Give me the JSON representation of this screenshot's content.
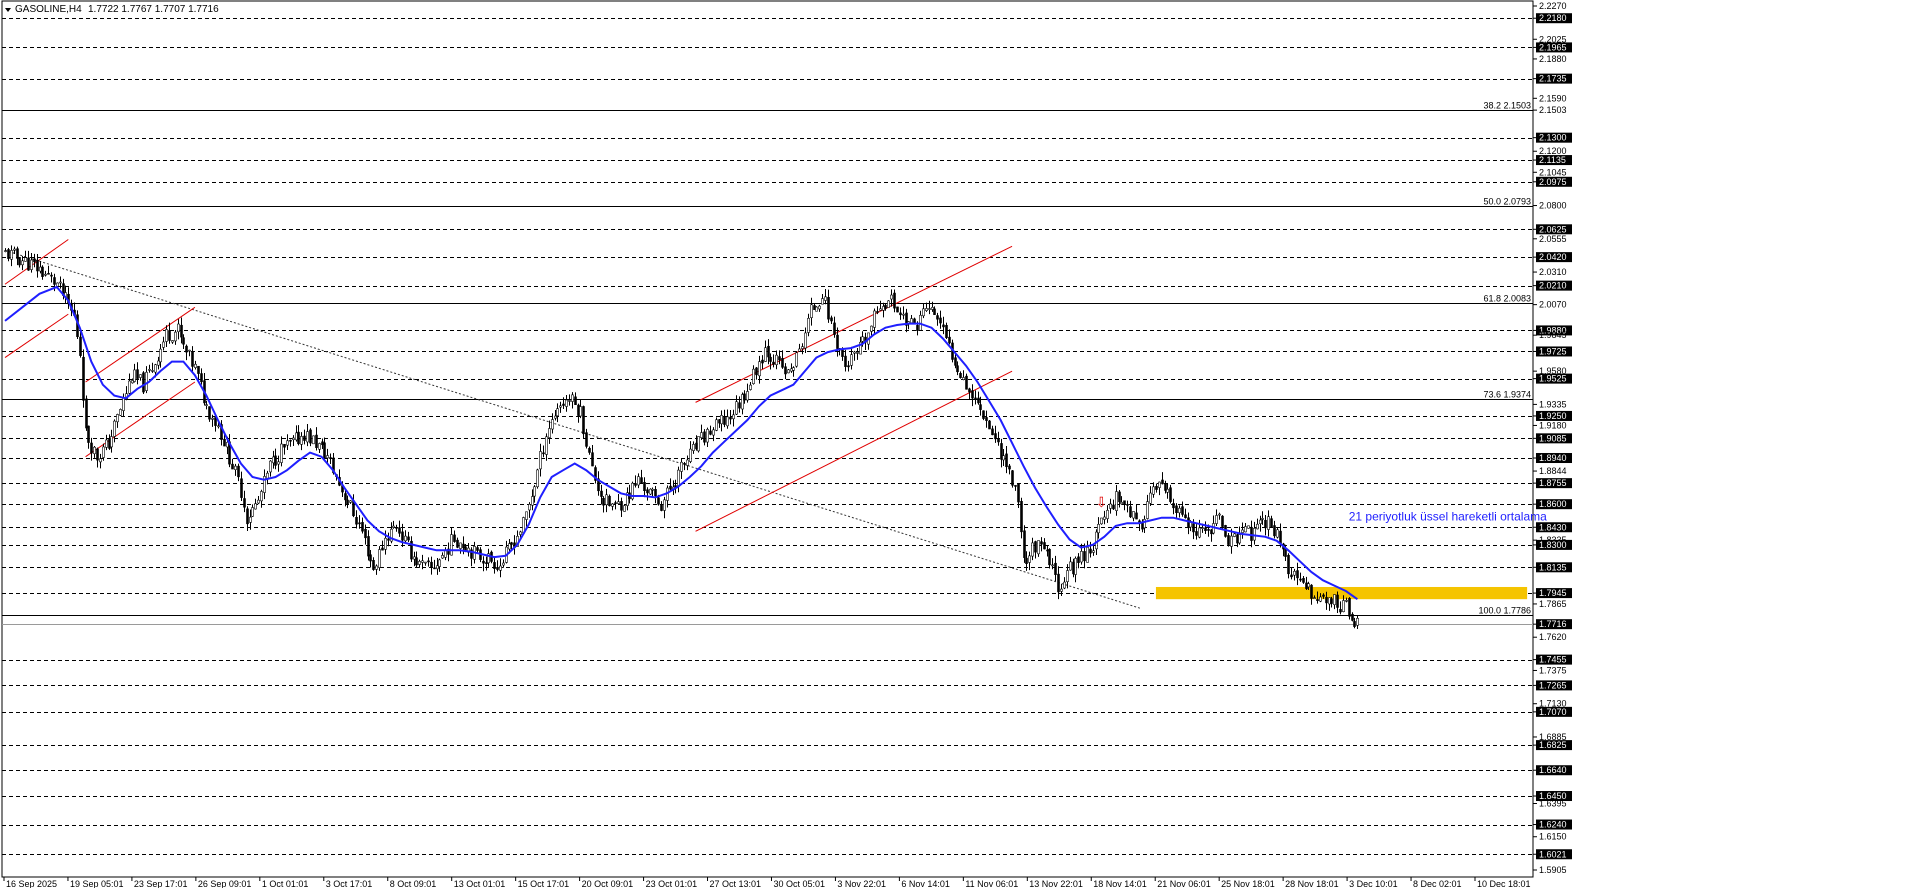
{
  "header": {
    "symbol": "GASOLINE,H4",
    "ohlc": "1.7722 1.7767 1.7707 1.7716"
  },
  "colors": {
    "background": "#ffffff",
    "grid": "#000000",
    "candle": "#000000",
    "ema": "#1f1fff",
    "channel": "#e00000",
    "zone": "#f5c400",
    "price_box": "#000000"
  },
  "chart_data": {
    "type": "candlestick",
    "symbol": "GASOLINE",
    "timeframe": "H4",
    "ylim": [
      1.5905,
      2.227
    ],
    "right_axis_ticks": [
      "2.2270",
      "2.2180",
      "2.2025",
      "2.1965",
      "2.1880",
      "2.1735",
      "2.1590",
      "2.1503",
      "2.1300",
      "2.1200",
      "2.1135",
      "2.1045",
      "2.0975",
      "2.0800",
      "2.0625",
      "2.0555",
      "2.0420",
      "2.0310",
      "2.0210",
      "2.0070",
      "1.9880",
      "1.9845",
      "1.9725",
      "1.9580",
      "1.9525",
      "1.9335",
      "1.9250",
      "1.9180",
      "1.9085",
      "1.8940",
      "1.8844",
      "1.8755",
      "1.8600",
      "1.8430",
      "1.8335",
      "1.8300",
      "1.8135",
      "1.7945",
      "1.7865",
      "1.7716",
      "1.7620",
      "1.7455",
      "1.7375",
      "1.7265",
      "1.7130",
      "1.7070",
      "1.6885",
      "1.6825",
      "1.6640",
      "1.6450",
      "1.6395",
      "1.6240",
      "1.6150",
      "1.6021",
      "1.5905"
    ],
    "boxed_levels": [
      "2.2180",
      "2.1965",
      "2.1735",
      "2.1300",
      "2.1135",
      "2.0975",
      "2.0625",
      "2.0420",
      "2.0210",
      "1.9880",
      "1.9725",
      "1.9525",
      "1.9250",
      "1.9085",
      "1.8940",
      "1.8755",
      "1.8600",
      "1.8430",
      "1.8300",
      "1.8135",
      "1.7945",
      "1.7716",
      "1.7455",
      "1.7265",
      "1.7070",
      "1.6825",
      "1.6640",
      "1.6450",
      "1.6240",
      "1.6021"
    ],
    "solid_levels": [
      "2.1503",
      "2.0793",
      "2.0083",
      "1.9374",
      "1.7786"
    ],
    "fib_levels": [
      {
        "label": "38.2 2.1503",
        "value": 2.1503
      },
      {
        "label": "50.0 2.0793",
        "value": 2.0793
      },
      {
        "label": "61.8 2.0083",
        "value": 2.0083
      },
      {
        "label": "73.6 1.9374",
        "value": 1.9374
      },
      {
        "label": "100.0 1.7786",
        "value": 1.7786
      }
    ],
    "current_price": "1.7716",
    "x_labels": [
      "16 Sep 2025",
      "19 Sep 05:01",
      "23 Sep 17:01",
      "26 Sep 09:01",
      "1 Oct 01:01",
      "3 Oct 17:01",
      "8 Oct 09:01",
      "13 Oct 01:01",
      "15 Oct 17:01",
      "20 Oct 09:01",
      "23 Oct 01:01",
      "27 Oct 13:01",
      "30 Oct 05:01",
      "3 Nov 22:01",
      "6 Nov 14:01",
      "11 Nov 06:01",
      "13 Nov 22:01",
      "18 Nov 14:01",
      "21 Nov 06:01",
      "25 Nov 18:01",
      "28 Nov 18:01",
      "3 Dec 10:01",
      "8 Dec 02:01",
      "10 Dec 18:01"
    ],
    "price_path": [
      [
        0,
        2.045
      ],
      [
        6,
        2.04
      ],
      [
        12,
        2.033
      ],
      [
        18,
        2.022
      ],
      [
        24,
        1.998
      ],
      [
        26,
        1.972
      ],
      [
        28,
        1.912
      ],
      [
        32,
        1.895
      ],
      [
        36,
        1.905
      ],
      [
        40,
        1.93
      ],
      [
        44,
        1.955
      ],
      [
        48,
        1.948
      ],
      [
        52,
        1.965
      ],
      [
        56,
        1.985
      ],
      [
        60,
        1.988
      ],
      [
        62,
        1.975
      ],
      [
        66,
        1.96
      ],
      [
        70,
        1.932
      ],
      [
        74,
        1.918
      ],
      [
        78,
        1.895
      ],
      [
        82,
        1.87
      ],
      [
        84,
        1.85
      ],
      [
        88,
        1.862
      ],
      [
        92,
        1.888
      ],
      [
        96,
        1.9
      ],
      [
        100,
        1.905
      ],
      [
        104,
        1.912
      ],
      [
        108,
        1.905
      ],
      [
        112,
        1.895
      ],
      [
        116,
        1.875
      ],
      [
        120,
        1.858
      ],
      [
        124,
        1.84
      ],
      [
        128,
        1.812
      ],
      [
        132,
        1.835
      ],
      [
        136,
        1.845
      ],
      [
        140,
        1.828
      ],
      [
        144,
        1.815
      ],
      [
        148,
        1.812
      ],
      [
        152,
        1.822
      ],
      [
        156,
        1.835
      ],
      [
        160,
        1.83
      ],
      [
        164,
        1.822
      ],
      [
        168,
        1.82
      ],
      [
        172,
        1.815
      ],
      [
        176,
        1.83
      ],
      [
        180,
        1.845
      ],
      [
        184,
        1.875
      ],
      [
        188,
        1.912
      ],
      [
        192,
        1.932
      ],
      [
        196,
        1.938
      ],
      [
        200,
        1.928
      ],
      [
        204,
        1.885
      ],
      [
        208,
        1.862
      ],
      [
        212,
        1.858
      ],
      [
        216,
        1.865
      ],
      [
        220,
        1.878
      ],
      [
        224,
        1.868
      ],
      [
        228,
        1.86
      ],
      [
        232,
        1.875
      ],
      [
        236,
        1.89
      ],
      [
        240,
        1.902
      ],
      [
        244,
        1.912
      ],
      [
        248,
        1.918
      ],
      [
        252,
        1.925
      ],
      [
        256,
        1.938
      ],
      [
        260,
        1.955
      ],
      [
        264,
        1.975
      ],
      [
        268,
        1.965
      ],
      [
        272,
        1.955
      ],
      [
        276,
        1.972
      ],
      [
        280,
        2.002
      ],
      [
        284,
        2.015
      ],
      [
        288,
        1.985
      ],
      [
        292,
        1.962
      ],
      [
        296,
        1.97
      ],
      [
        300,
        1.985
      ],
      [
        304,
        2.008
      ],
      [
        308,
        2.01
      ],
      [
        312,
        1.998
      ],
      [
        316,
        1.99
      ],
      [
        320,
        2.005
      ],
      [
        324,
        1.998
      ],
      [
        328,
        1.975
      ],
      [
        332,
        1.958
      ],
      [
        336,
        1.94
      ],
      [
        340,
        1.928
      ],
      [
        344,
        1.908
      ],
      [
        348,
        1.89
      ],
      [
        350,
        1.876
      ],
      [
        352,
        1.865
      ],
      [
        354,
        1.818
      ],
      [
        358,
        1.83
      ],
      [
        362,
        1.822
      ],
      [
        366,
        1.8
      ],
      [
        370,
        1.812
      ],
      [
        374,
        1.822
      ],
      [
        378,
        1.83
      ],
      [
        382,
        1.852
      ],
      [
        386,
        1.866
      ],
      [
        390,
        1.86
      ],
      [
        394,
        1.84
      ],
      [
        398,
        1.868
      ],
      [
        402,
        1.872
      ],
      [
        406,
        1.858
      ],
      [
        410,
        1.848
      ],
      [
        414,
        1.835
      ],
      [
        418,
        1.842
      ],
      [
        422,
        1.848
      ],
      [
        426,
        1.832
      ],
      [
        430,
        1.84
      ],
      [
        434,
        1.838
      ],
      [
        438,
        1.848
      ],
      [
        442,
        1.84
      ],
      [
        446,
        1.812
      ],
      [
        450,
        1.8
      ],
      [
        454,
        1.795
      ],
      [
        458,
        1.79
      ],
      [
        462,
        1.788
      ],
      [
        466,
        1.785
      ],
      [
        468,
        1.775
      ],
      [
        470,
        1.7716
      ]
    ],
    "ema_21_path": [
      [
        0,
        1.995
      ],
      [
        6,
        2.005
      ],
      [
        12,
        2.015
      ],
      [
        18,
        2.02
      ],
      [
        22,
        2.01
      ],
      [
        26,
        1.99
      ],
      [
        30,
        1.965
      ],
      [
        34,
        1.948
      ],
      [
        38,
        1.94
      ],
      [
        42,
        1.938
      ],
      [
        46,
        1.945
      ],
      [
        50,
        1.95
      ],
      [
        54,
        1.958
      ],
      [
        58,
        1.965
      ],
      [
        62,
        1.965
      ],
      [
        66,
        1.955
      ],
      [
        70,
        1.94
      ],
      [
        74,
        1.922
      ],
      [
        78,
        1.905
      ],
      [
        82,
        1.89
      ],
      [
        86,
        1.88
      ],
      [
        90,
        1.878
      ],
      [
        94,
        1.88
      ],
      [
        98,
        1.885
      ],
      [
        102,
        1.892
      ],
      [
        106,
        1.898
      ],
      [
        110,
        1.895
      ],
      [
        114,
        1.885
      ],
      [
        118,
        1.872
      ],
      [
        122,
        1.86
      ],
      [
        126,
        1.848
      ],
      [
        130,
        1.84
      ],
      [
        134,
        1.835
      ],
      [
        138,
        1.832
      ],
      [
        142,
        1.83
      ],
      [
        146,
        1.828
      ],
      [
        150,
        1.826
      ],
      [
        154,
        1.826
      ],
      [
        158,
        1.826
      ],
      [
        162,
        1.825
      ],
      [
        166,
        1.823
      ],
      [
        170,
        1.821
      ],
      [
        174,
        1.822
      ],
      [
        178,
        1.83
      ],
      [
        182,
        1.845
      ],
      [
        186,
        1.865
      ],
      [
        190,
        1.88
      ],
      [
        194,
        1.885
      ],
      [
        198,
        1.89
      ],
      [
        202,
        1.885
      ],
      [
        206,
        1.878
      ],
      [
        210,
        1.873
      ],
      [
        214,
        1.868
      ],
      [
        218,
        1.866
      ],
      [
        222,
        1.866
      ],
      [
        226,
        1.865
      ],
      [
        230,
        1.868
      ],
      [
        234,
        1.873
      ],
      [
        238,
        1.88
      ],
      [
        242,
        1.888
      ],
      [
        246,
        1.898
      ],
      [
        250,
        1.906
      ],
      [
        254,
        1.914
      ],
      [
        258,
        1.922
      ],
      [
        262,
        1.932
      ],
      [
        266,
        1.94
      ],
      [
        270,
        1.944
      ],
      [
        274,
        1.948
      ],
      [
        278,
        1.958
      ],
      [
        282,
        1.968
      ],
      [
        286,
        1.972
      ],
      [
        290,
        1.974
      ],
      [
        294,
        1.975
      ],
      [
        298,
        1.978
      ],
      [
        302,
        1.985
      ],
      [
        306,
        1.99
      ],
      [
        310,
        1.992
      ],
      [
        314,
        1.993
      ],
      [
        318,
        1.993
      ],
      [
        322,
        1.99
      ],
      [
        326,
        1.982
      ],
      [
        330,
        1.972
      ],
      [
        334,
        1.962
      ],
      [
        338,
        1.95
      ],
      [
        342,
        1.936
      ],
      [
        346,
        1.922
      ],
      [
        350,
        1.905
      ],
      [
        354,
        1.888
      ],
      [
        358,
        1.872
      ],
      [
        362,
        1.858
      ],
      [
        366,
        1.845
      ],
      [
        370,
        1.834
      ],
      [
        374,
        1.828
      ],
      [
        378,
        1.83
      ],
      [
        382,
        1.836
      ],
      [
        386,
        1.844
      ],
      [
        390,
        1.846
      ],
      [
        394,
        1.846
      ],
      [
        398,
        1.848
      ],
      [
        402,
        1.85
      ],
      [
        406,
        1.85
      ],
      [
        410,
        1.848
      ],
      [
        414,
        1.846
      ],
      [
        418,
        1.844
      ],
      [
        422,
        1.842
      ],
      [
        426,
        1.84
      ],
      [
        430,
        1.838
      ],
      [
        434,
        1.837
      ],
      [
        438,
        1.836
      ],
      [
        442,
        1.833
      ],
      [
        446,
        1.826
      ],
      [
        450,
        1.818
      ],
      [
        454,
        1.81
      ],
      [
        458,
        1.804
      ],
      [
        462,
        1.8
      ],
      [
        466,
        1.796
      ],
      [
        470,
        1.79
      ]
    ],
    "channels": [
      {
        "upper": [
          [
            0,
            2.022
          ],
          [
            22,
            2.055
          ]
        ],
        "lower": [
          [
            0,
            1.968
          ],
          [
            22,
            2.0
          ]
        ]
      },
      {
        "upper": [
          [
            28,
            1.95
          ],
          [
            66,
            2.005
          ]
        ],
        "lower": [
          [
            28,
            1.895
          ],
          [
            66,
            1.95
          ]
        ]
      },
      {
        "upper": [
          [
            240,
            1.935
          ],
          [
            350,
            2.05
          ]
        ],
        "lower": [
          [
            240,
            1.84
          ],
          [
            350,
            1.958
          ]
        ]
      }
    ],
    "trendline": {
      "from": [
        0,
        2.047
      ],
      "to": [
        395,
        1.783
      ]
    },
    "zone": {
      "from": 400,
      "to": 529,
      "high": 1.799,
      "low": 1.79
    },
    "annotation": {
      "text": "21 periyotluk üssel hareketli ortalama",
      "at": [
        467,
        1.848
      ]
    },
    "arrow": {
      "glyph": "⇩",
      "at": [
        379,
        1.858
      ]
    }
  }
}
